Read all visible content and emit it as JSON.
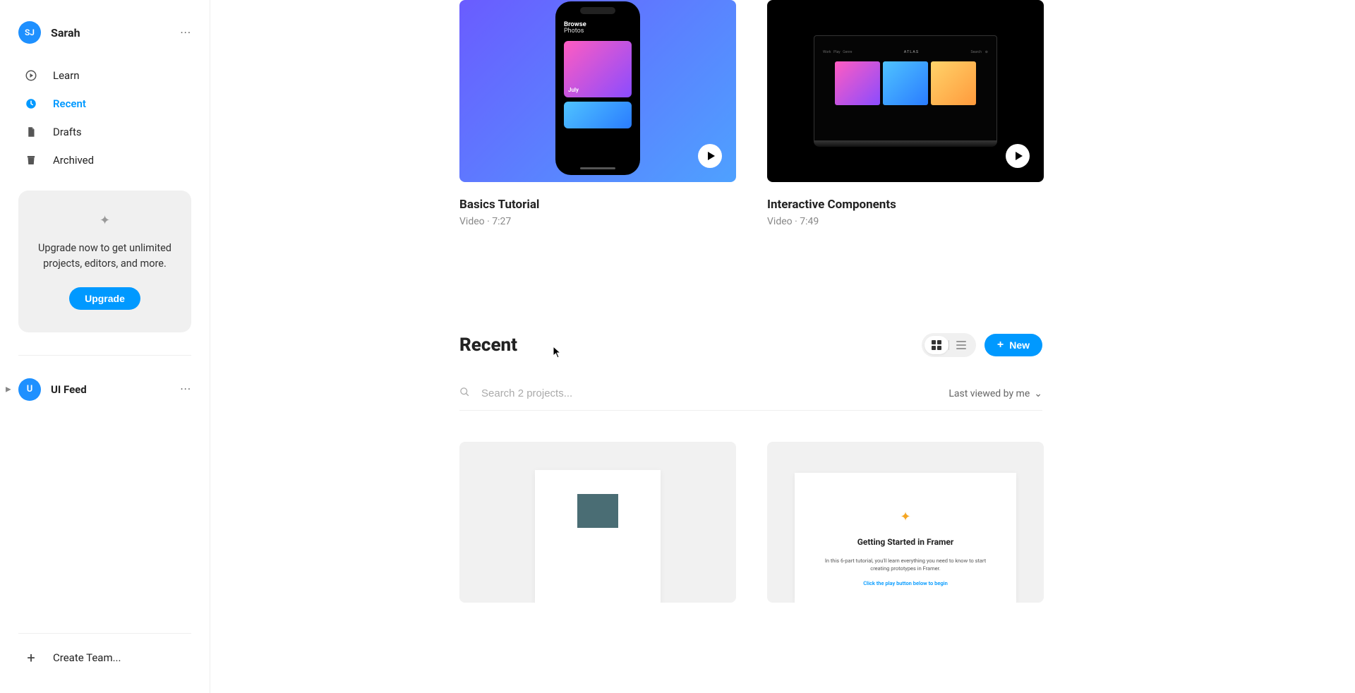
{
  "user": {
    "initials": "SJ",
    "name": "Sarah"
  },
  "nav": {
    "learn": "Learn",
    "recent": "Recent",
    "drafts": "Drafts",
    "archived": "Archived"
  },
  "upgrade": {
    "text": "Upgrade now to get unlimited projects, editors, and more.",
    "button": "Upgrade"
  },
  "team": {
    "initial": "U",
    "name": "UI Feed"
  },
  "create_team_label": "Create Team...",
  "tutorials": [
    {
      "title": "Basics Tutorial",
      "meta": "Video · 7:27",
      "browse_label_bold": "Browse",
      "browse_label_sub": "Photos",
      "tile_label": "July"
    },
    {
      "title": "Interactive Components",
      "meta": "Video · 7:49",
      "brand": "ATLAS"
    }
  ],
  "section": {
    "title": "Recent",
    "new_button": "New",
    "search_placeholder": "Search 2 projects...",
    "sort_label": "Last viewed by me"
  },
  "projects": {
    "getting_started": {
      "title": "Getting Started in Framer",
      "text": "In this 6-part tutorial, you'll learn everything you need to know to start creating prototypes in Framer.",
      "link": "Click the play button below to begin"
    }
  }
}
